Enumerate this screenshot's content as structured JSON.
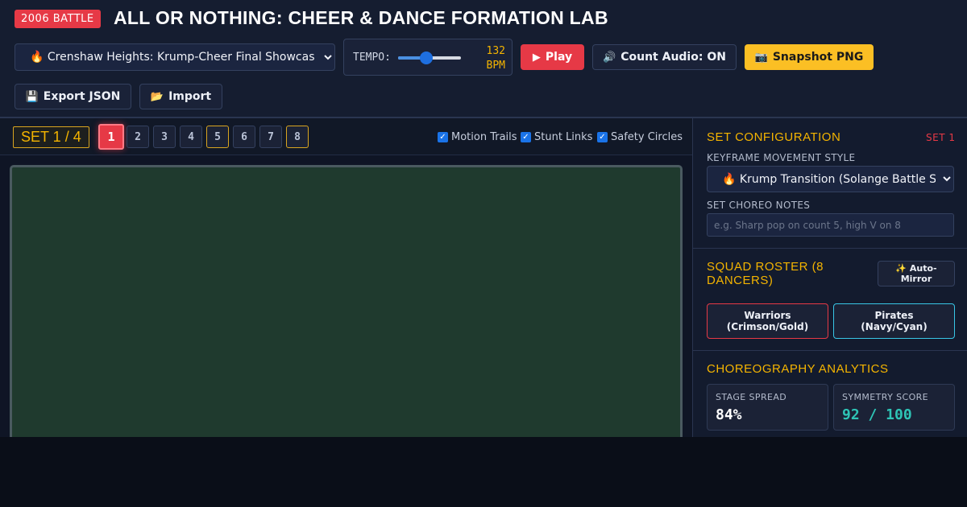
{
  "header": {
    "badge": "2006 BATTLE",
    "title": "ALL OR NOTHING: CHEER & DANCE FORMATION LAB",
    "preset": {
      "selected": "🔥 Crenshaw Heights: Krump-Cheer Final Showcase"
    },
    "tempo": {
      "label": "TEMPO:",
      "value": 132,
      "unit": "BPM",
      "slider_fraction": 0.45
    },
    "buttons": {
      "play": "Play",
      "audio": "Count Audio: ON",
      "snapshot": "Snapshot PNG",
      "export": "Export JSON",
      "import": "Import"
    },
    "icons": {
      "play": "play-icon",
      "audio": "speaker-icon",
      "snapshot": "camera-icon",
      "export": "floppy-disk-icon",
      "import": "folder-open-icon"
    }
  },
  "setbar": {
    "indicator": "SET 1 / 4",
    "counts": [
      "1",
      "2",
      "3",
      "4",
      "5",
      "6",
      "7",
      "8"
    ],
    "active_count": "1",
    "accent_counts": [
      "5",
      "8"
    ],
    "toggles": {
      "motion_trails": "Motion Trails",
      "stunt_links": "Stunt Links",
      "safety_circles": "Safety Circles"
    }
  },
  "config": {
    "title": "SET CONFIGURATION",
    "tag": "SET 1",
    "style_label": "KEYFRAME MOVEMENT STYLE",
    "style_selected": "🔥 Krump Transition (Solange Battle St",
    "notes_label": "SET CHOREO NOTES",
    "notes_placeholder": "e.g. Sharp pop on count 5, high V on 8",
    "notes_value": ""
  },
  "roster": {
    "title_line1": "SQUAD ROSTER (8",
    "title_line2": "DANCERS)",
    "mirror_line1": "✨ Auto-",
    "mirror_line2": "Mirror",
    "teams": [
      {
        "line1": "Warriors",
        "line2": "(Crimson/Gold)"
      },
      {
        "line1": "Pirates",
        "line2": "(Navy/Cyan)"
      }
    ]
  },
  "analytics": {
    "title": "CHOREOGRAPHY ANALYTICS",
    "stats": [
      {
        "label": "STAGE SPREAD",
        "value": "84%"
      },
      {
        "label": "SYMMETRY SCORE",
        "value": "92 / 100"
      }
    ]
  },
  "colors": {
    "accent_red": "#e63946",
    "accent_gold": "#f4b400",
    "snapshot_yellow": "#fbbf24",
    "cyan": "#38c6e6",
    "teal_score": "#2ec4b6",
    "stage_green": "#1f3a2e"
  }
}
